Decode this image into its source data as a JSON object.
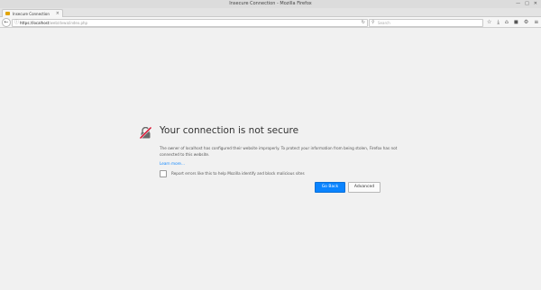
{
  "window": {
    "title": "Insecure Connection - Mozilla Firefox",
    "controls": [
      "—",
      "□",
      "✕"
    ]
  },
  "tabs": [
    {
      "label": "Insecure Connection",
      "close": "×"
    }
  ],
  "new_tab": "+",
  "navbar": {
    "back": "←",
    "url_host": "https://localhost",
    "url_path": "/web/dvwa/index.php",
    "reload": "↻",
    "search_placeholder": "Search",
    "search_glyph": "⚲",
    "toolbar_icons": [
      "☆",
      "⤓",
      "⌂",
      "◼",
      "⚙",
      "≡"
    ]
  },
  "error": {
    "title": "Your connection is not secure",
    "description": "The owner of localhost has configured their website improperly. To protect your information from being stolen, Firefox has not connected to this website.",
    "learn_more": "Learn more…",
    "report_label": "Report errors like this to help Mozilla identify and block malicious sites",
    "go_back": "Go Back",
    "advanced": "Advanced"
  },
  "colors": {
    "accent": "#0a84ff",
    "warning_icon_red": "#d70022"
  }
}
